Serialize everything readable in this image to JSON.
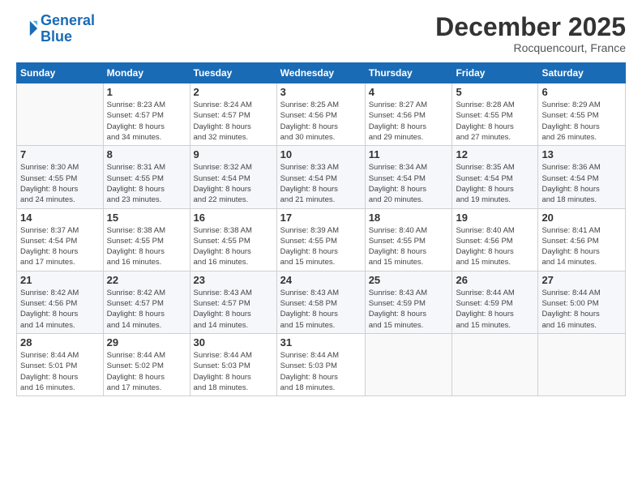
{
  "logo": {
    "line1": "General",
    "line2": "Blue"
  },
  "title": "December 2025",
  "location": "Rocquencourt, France",
  "weekdays": [
    "Sunday",
    "Monday",
    "Tuesday",
    "Wednesday",
    "Thursday",
    "Friday",
    "Saturday"
  ],
  "weeks": [
    [
      {
        "day": "",
        "info": ""
      },
      {
        "day": "1",
        "info": "Sunrise: 8:23 AM\nSunset: 4:57 PM\nDaylight: 8 hours\nand 34 minutes."
      },
      {
        "day": "2",
        "info": "Sunrise: 8:24 AM\nSunset: 4:57 PM\nDaylight: 8 hours\nand 32 minutes."
      },
      {
        "day": "3",
        "info": "Sunrise: 8:25 AM\nSunset: 4:56 PM\nDaylight: 8 hours\nand 30 minutes."
      },
      {
        "day": "4",
        "info": "Sunrise: 8:27 AM\nSunset: 4:56 PM\nDaylight: 8 hours\nand 29 minutes."
      },
      {
        "day": "5",
        "info": "Sunrise: 8:28 AM\nSunset: 4:55 PM\nDaylight: 8 hours\nand 27 minutes."
      },
      {
        "day": "6",
        "info": "Sunrise: 8:29 AM\nSunset: 4:55 PM\nDaylight: 8 hours\nand 26 minutes."
      }
    ],
    [
      {
        "day": "7",
        "info": "Sunrise: 8:30 AM\nSunset: 4:55 PM\nDaylight: 8 hours\nand 24 minutes."
      },
      {
        "day": "8",
        "info": "Sunrise: 8:31 AM\nSunset: 4:55 PM\nDaylight: 8 hours\nand 23 minutes."
      },
      {
        "day": "9",
        "info": "Sunrise: 8:32 AM\nSunset: 4:54 PM\nDaylight: 8 hours\nand 22 minutes."
      },
      {
        "day": "10",
        "info": "Sunrise: 8:33 AM\nSunset: 4:54 PM\nDaylight: 8 hours\nand 21 minutes."
      },
      {
        "day": "11",
        "info": "Sunrise: 8:34 AM\nSunset: 4:54 PM\nDaylight: 8 hours\nand 20 minutes."
      },
      {
        "day": "12",
        "info": "Sunrise: 8:35 AM\nSunset: 4:54 PM\nDaylight: 8 hours\nand 19 minutes."
      },
      {
        "day": "13",
        "info": "Sunrise: 8:36 AM\nSunset: 4:54 PM\nDaylight: 8 hours\nand 18 minutes."
      }
    ],
    [
      {
        "day": "14",
        "info": "Sunrise: 8:37 AM\nSunset: 4:54 PM\nDaylight: 8 hours\nand 17 minutes."
      },
      {
        "day": "15",
        "info": "Sunrise: 8:38 AM\nSunset: 4:55 PM\nDaylight: 8 hours\nand 16 minutes."
      },
      {
        "day": "16",
        "info": "Sunrise: 8:38 AM\nSunset: 4:55 PM\nDaylight: 8 hours\nand 16 minutes."
      },
      {
        "day": "17",
        "info": "Sunrise: 8:39 AM\nSunset: 4:55 PM\nDaylight: 8 hours\nand 15 minutes."
      },
      {
        "day": "18",
        "info": "Sunrise: 8:40 AM\nSunset: 4:55 PM\nDaylight: 8 hours\nand 15 minutes."
      },
      {
        "day": "19",
        "info": "Sunrise: 8:40 AM\nSunset: 4:56 PM\nDaylight: 8 hours\nand 15 minutes."
      },
      {
        "day": "20",
        "info": "Sunrise: 8:41 AM\nSunset: 4:56 PM\nDaylight: 8 hours\nand 14 minutes."
      }
    ],
    [
      {
        "day": "21",
        "info": "Sunrise: 8:42 AM\nSunset: 4:56 PM\nDaylight: 8 hours\nand 14 minutes."
      },
      {
        "day": "22",
        "info": "Sunrise: 8:42 AM\nSunset: 4:57 PM\nDaylight: 8 hours\nand 14 minutes."
      },
      {
        "day": "23",
        "info": "Sunrise: 8:43 AM\nSunset: 4:57 PM\nDaylight: 8 hours\nand 14 minutes."
      },
      {
        "day": "24",
        "info": "Sunrise: 8:43 AM\nSunset: 4:58 PM\nDaylight: 8 hours\nand 15 minutes."
      },
      {
        "day": "25",
        "info": "Sunrise: 8:43 AM\nSunset: 4:59 PM\nDaylight: 8 hours\nand 15 minutes."
      },
      {
        "day": "26",
        "info": "Sunrise: 8:44 AM\nSunset: 4:59 PM\nDaylight: 8 hours\nand 15 minutes."
      },
      {
        "day": "27",
        "info": "Sunrise: 8:44 AM\nSunset: 5:00 PM\nDaylight: 8 hours\nand 16 minutes."
      }
    ],
    [
      {
        "day": "28",
        "info": "Sunrise: 8:44 AM\nSunset: 5:01 PM\nDaylight: 8 hours\nand 16 minutes."
      },
      {
        "day": "29",
        "info": "Sunrise: 8:44 AM\nSunset: 5:02 PM\nDaylight: 8 hours\nand 17 minutes."
      },
      {
        "day": "30",
        "info": "Sunrise: 8:44 AM\nSunset: 5:03 PM\nDaylight: 8 hours\nand 18 minutes."
      },
      {
        "day": "31",
        "info": "Sunrise: 8:44 AM\nSunset: 5:03 PM\nDaylight: 8 hours\nand 18 minutes."
      },
      {
        "day": "",
        "info": ""
      },
      {
        "day": "",
        "info": ""
      },
      {
        "day": "",
        "info": ""
      }
    ]
  ]
}
